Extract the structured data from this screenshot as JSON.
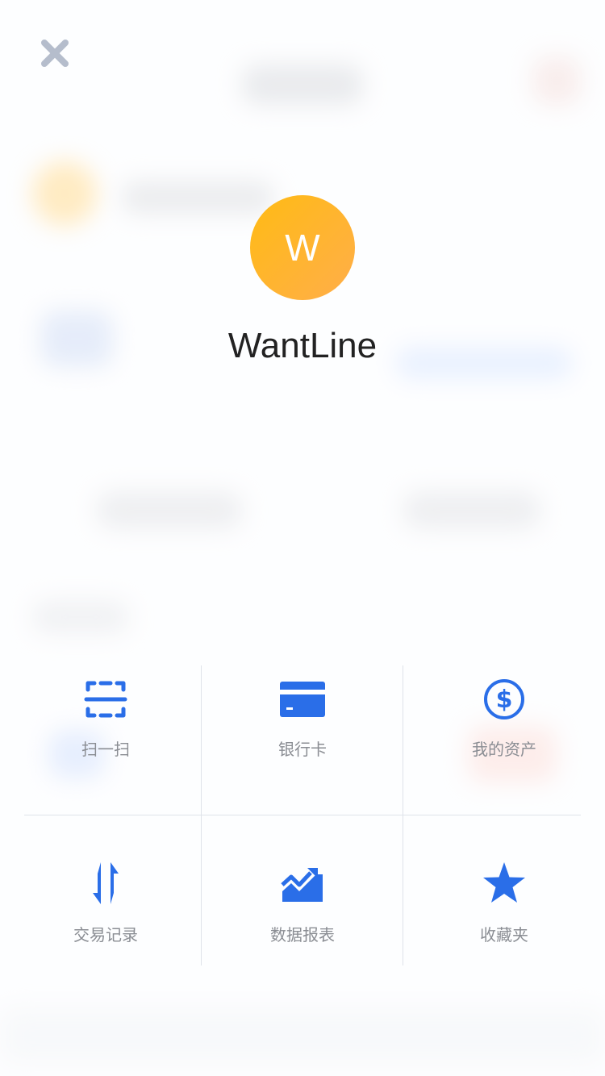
{
  "user": {
    "avatar_letter": "W",
    "name": "WantLine"
  },
  "menu": {
    "items": [
      {
        "label": "扫一扫",
        "icon": "scan-icon"
      },
      {
        "label": "银行卡",
        "icon": "bank-card-icon"
      },
      {
        "label": "我的资产",
        "icon": "dollar-icon"
      },
      {
        "label": "交易记录",
        "icon": "transfer-arrows-icon"
      },
      {
        "label": "数据报表",
        "icon": "chart-trend-icon"
      },
      {
        "label": "收藏夹",
        "icon": "star-icon"
      }
    ]
  },
  "colors": {
    "accent": "#2a6ee8",
    "avatar_start": "#ffbb14",
    "avatar_end": "#ffae4a",
    "close": "#b5bdcc"
  }
}
